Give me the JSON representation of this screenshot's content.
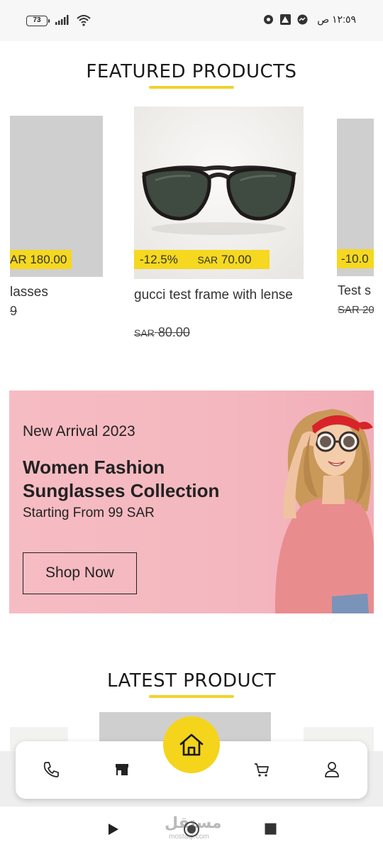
{
  "status_bar": {
    "battery": "73",
    "time": "١٢:٥٩ ص",
    "icons": [
      "settings-app-icon",
      "gallery-app-icon",
      "messenger-icon"
    ]
  },
  "featured": {
    "title": "FEATURED PRODUCTS",
    "products": [
      {
        "name_partial": "lasses",
        "discount_price_partial": "AR 180.00",
        "old_price_partial": "9"
      },
      {
        "name": "gucci test frame with lense",
        "discount": "-12.5%",
        "currency": "SAR",
        "price": "70.00",
        "old_currency": "SAR",
        "old_price": "80.00"
      },
      {
        "name_partial": "Test s",
        "discount_partial": "-10.0",
        "old_price_partial": "SAR 20"
      }
    ]
  },
  "banner": {
    "subtitle": "New Arrival 2023",
    "title": "Women Fashion Sunglasses Collection",
    "line": "Starting From 99 SAR",
    "button": "Shop Now",
    "background": "#f6bcc3"
  },
  "latest": {
    "title": "LATEST PRODUCT"
  },
  "bottom_nav": {
    "items": [
      "phone-icon",
      "store-icon",
      "home-icon",
      "cart-icon",
      "user-icon"
    ],
    "active": "home",
    "accent": "#f5d41c"
  },
  "system_nav": {
    "watermark": "مستقل",
    "watermark_sub": "mostaql.com"
  }
}
